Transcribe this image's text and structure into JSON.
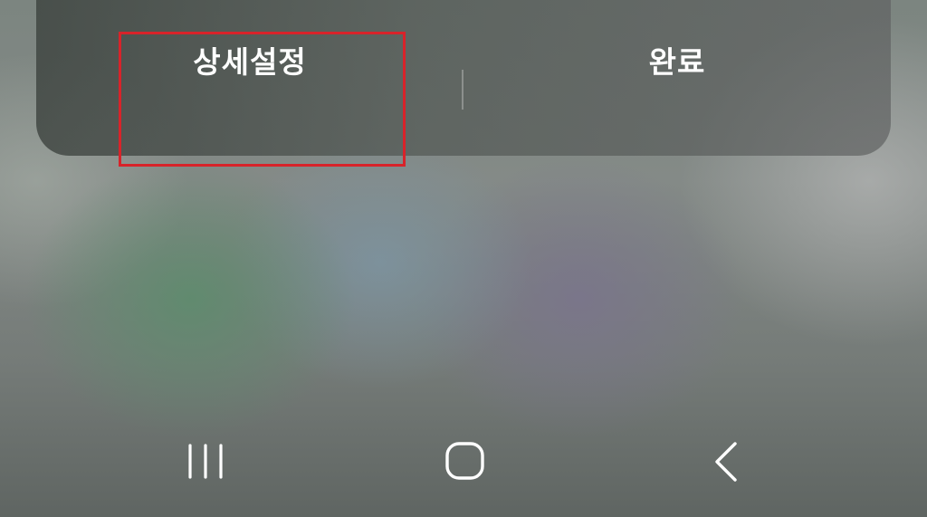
{
  "dialog": {
    "advanced_settings_label": "상세설정",
    "done_label": "완료"
  },
  "highlight": {
    "target": "advanced_settings_label",
    "color": "#d8232a"
  },
  "navbar": {
    "icons": [
      "recent-apps-icon",
      "home-icon",
      "back-icon"
    ],
    "icon_color": "#ffffff"
  }
}
